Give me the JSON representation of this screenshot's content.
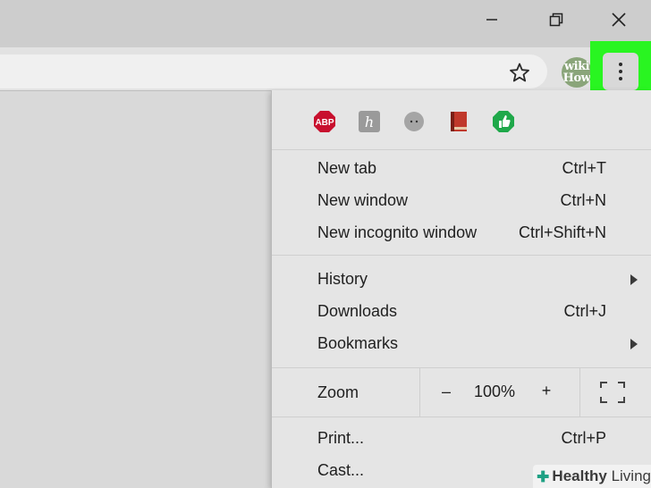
{
  "window": {
    "minimize_icon": "minimize-icon",
    "restore_icon": "restore-icon",
    "close_icon": "close-icon"
  },
  "toolbar": {
    "bookmark_icon": "star-icon",
    "profile_badge": {
      "line1": "wiki",
      "line2": "How"
    },
    "menu_icon": "three-dot-menu-icon",
    "highlight_color": "#29f521"
  },
  "menu": {
    "extensions": [
      {
        "name": "abp-extension-icon",
        "label": "ABP",
        "color": "#c8102e"
      },
      {
        "name": "honey-extension-icon",
        "label": "h",
        "color": "#9a9a9a"
      },
      {
        "name": "face-extension-icon",
        "label": "",
        "color": "#a5a5a5"
      },
      {
        "name": "book-extension-icon",
        "label": "",
        "color": "#c0392b"
      },
      {
        "name": "thumbs-up-extension-icon",
        "label": "",
        "color": "#1fa84a"
      }
    ],
    "items": [
      {
        "label": "New tab",
        "shortcut": "Ctrl+T"
      },
      {
        "label": "New window",
        "shortcut": "Ctrl+N"
      },
      {
        "label": "New incognito window",
        "shortcut": "Ctrl+Shift+N"
      },
      {
        "label": "History",
        "shortcut": ""
      },
      {
        "label": "Downloads",
        "shortcut": "Ctrl+J"
      },
      {
        "label": "Bookmarks",
        "shortcut": ""
      },
      {
        "label": "Print...",
        "shortcut": "Ctrl+P"
      },
      {
        "label": "Cast...",
        "shortcut": ""
      }
    ],
    "zoom": {
      "label": "Zoom",
      "minus": "–",
      "value": "100%",
      "plus": "+",
      "fullscreen_icon": "fullscreen-icon"
    }
  },
  "watermark": {
    "brand_bold": "Healthy",
    "brand_light": "Living",
    "accent_color": "#1fa184"
  }
}
